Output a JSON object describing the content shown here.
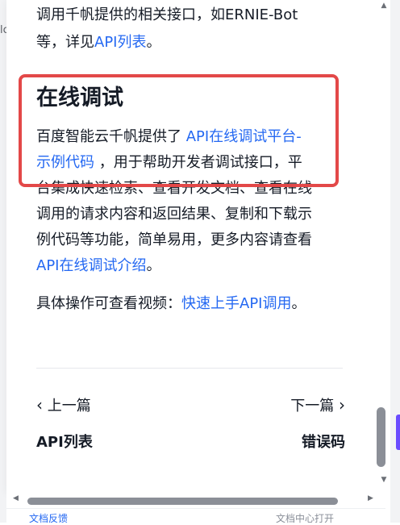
{
  "article": {
    "para1_line1": "调用千帆提供的相关接口，如ERNIE-Bot",
    "para1_line2_prefix": "等，详见",
    "para1_link": "API列表",
    "para1_line2_suffix": "。",
    "heading": "在线调试",
    "intro_line1_text": "百度智能云千帆提供了 ",
    "intro_link_part1": "API在线调试平台-",
    "intro_link_part2": "示例代码",
    "intro_line2_suffix": " ，用于帮助开发者调试接口，平",
    "intro_line3": "台集成快速检索、查看开发文档、查看在线",
    "intro_line4": "调用的请求内容和返回结果、复制和下载示",
    "intro_line5": "例代码等功能，简单易用，更多内容请查看",
    "intro_link2": "API在线调试介绍",
    "intro_line6_suffix": "。",
    "video_prefix": "具体操作可查看视频：",
    "video_link": "快速上手API调用",
    "video_suffix": "。"
  },
  "pager": {
    "prev_label": "上一篇",
    "prev_title": "API列表",
    "next_label": "下一篇",
    "next_title": "错误码"
  },
  "footer": {
    "left_text": "文档反馈",
    "right_text": "文档中心打开"
  },
  "background": {
    "left_cut_text": "lc"
  },
  "colors": {
    "link": "#2468f2",
    "highlight": "#e34848",
    "text": "#151b26"
  },
  "icons": {
    "prev": "chevron-left-icon",
    "next": "chevron-right-icon"
  }
}
